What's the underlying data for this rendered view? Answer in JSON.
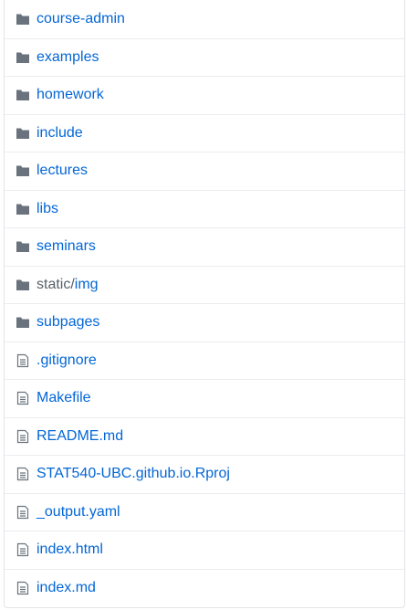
{
  "file_browser": {
    "entries": [
      {
        "type": "folder",
        "prefix": "",
        "name": "course-admin",
        "icon": "folder-icon"
      },
      {
        "type": "folder",
        "prefix": "",
        "name": "examples",
        "icon": "folder-icon"
      },
      {
        "type": "folder",
        "prefix": "",
        "name": "homework",
        "icon": "folder-icon"
      },
      {
        "type": "folder",
        "prefix": "",
        "name": "include",
        "icon": "folder-icon"
      },
      {
        "type": "folder",
        "prefix": "",
        "name": "lectures",
        "icon": "folder-icon"
      },
      {
        "type": "folder",
        "prefix": "",
        "name": "libs",
        "icon": "folder-icon"
      },
      {
        "type": "folder",
        "prefix": "",
        "name": "seminars",
        "icon": "folder-icon"
      },
      {
        "type": "folder",
        "prefix": "static/",
        "name": "img",
        "icon": "folder-icon"
      },
      {
        "type": "folder",
        "prefix": "",
        "name": "subpages",
        "icon": "folder-icon"
      },
      {
        "type": "file",
        "prefix": "",
        "name": ".gitignore",
        "icon": "file-icon"
      },
      {
        "type": "file",
        "prefix": "",
        "name": "Makefile",
        "icon": "file-icon"
      },
      {
        "type": "file",
        "prefix": "",
        "name": "README.md",
        "icon": "file-icon"
      },
      {
        "type": "file",
        "prefix": "",
        "name": "STAT540-UBC.github.io.Rproj",
        "icon": "file-icon"
      },
      {
        "type": "file",
        "prefix": "",
        "name": "_output.yaml",
        "icon": "file-icon"
      },
      {
        "type": "file",
        "prefix": "",
        "name": "index.html",
        "icon": "file-icon"
      },
      {
        "type": "file",
        "prefix": "",
        "name": "index.md",
        "icon": "file-icon"
      }
    ]
  },
  "colors": {
    "link": "#0366d6",
    "folder_icon": "#79b8ff",
    "file_icon": "#6a737d",
    "muted_text": "#586069",
    "border": "#eaecef"
  }
}
